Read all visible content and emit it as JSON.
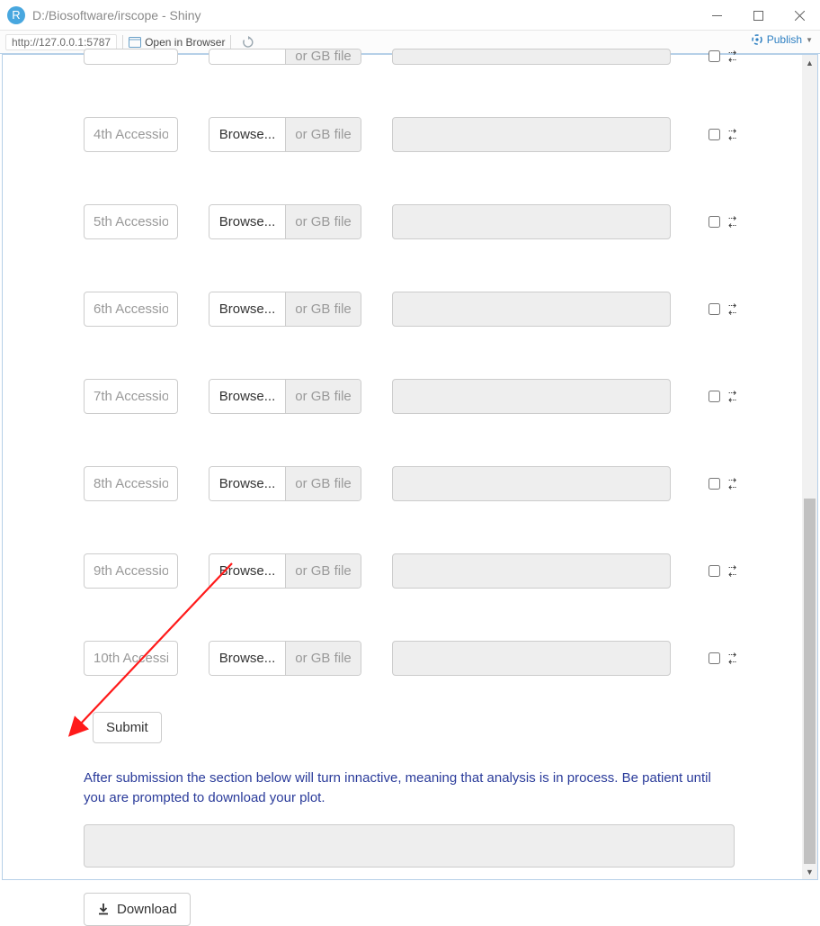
{
  "window": {
    "icon_letter": "R",
    "title": "D:/Biosoftware/irscope - Shiny"
  },
  "toolbar": {
    "url": "http://127.0.0.1:5787",
    "open_browser": "Open in Browser",
    "publish": "Publish"
  },
  "rows": [
    {
      "id": "row3",
      "placeholder": ""
    },
    {
      "id": "row4",
      "placeholder": "4th Accessio"
    },
    {
      "id": "row5",
      "placeholder": "5th Accessio"
    },
    {
      "id": "row6",
      "placeholder": "6th Accessio"
    },
    {
      "id": "row7",
      "placeholder": "7th Accessio"
    },
    {
      "id": "row8",
      "placeholder": "8th Accessio"
    },
    {
      "id": "row9",
      "placeholder": "9th Accessio"
    },
    {
      "id": "row10",
      "placeholder": "10th Accessi"
    }
  ],
  "file_input": {
    "browse_label": "Browse...",
    "or_label": "or GB file"
  },
  "submit_label": "Submit",
  "info_text": "After submission the section below will turn innactive, meaning that analysis is in process. Be patient until you are prompted to download your plot.",
  "download_label": "Download",
  "scrollbar": {
    "thumb_top_pct": 54,
    "thumb_height_pct": 46
  }
}
